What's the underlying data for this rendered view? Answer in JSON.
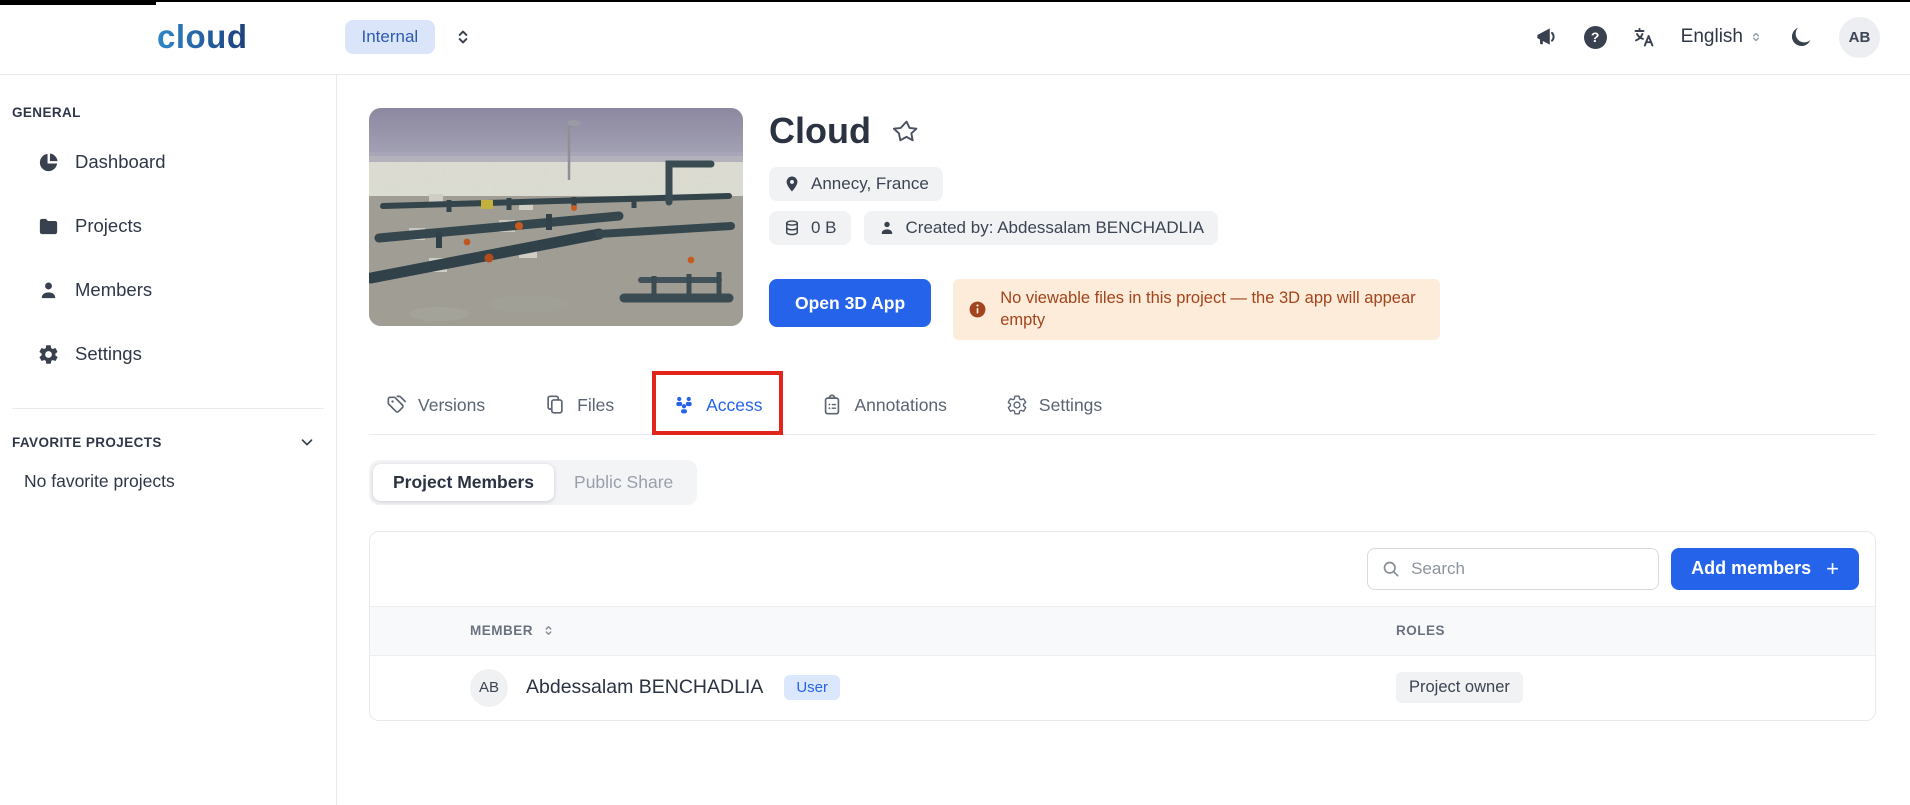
{
  "colors": {
    "accent": "#2563eb",
    "highlight_red": "#e1251b",
    "warning_bg": "#fcecd9",
    "warning_text": "#a2441d",
    "badge_bg": "#f1f2f4",
    "user_badge_bg": "#dbe7fd"
  },
  "header": {
    "logo": "cloud",
    "workspace_badge": "Internal",
    "help_glyph": "?",
    "language": "English",
    "avatar_initials": "AB"
  },
  "sidebar": {
    "general_label": "GENERAL",
    "items": [
      {
        "label": "Dashboard",
        "icon": "pie-chart-icon"
      },
      {
        "label": "Projects",
        "icon": "folder-icon"
      },
      {
        "label": "Members",
        "icon": "person-icon"
      },
      {
        "label": "Settings",
        "icon": "gear-icon"
      }
    ],
    "favorites_label": "FAVORITE PROJECTS",
    "favorites_empty": "No favorite projects"
  },
  "project": {
    "title": "Cloud",
    "location": "Annecy, France",
    "size": "0 B",
    "created_by": "Created by: Abdessalam BENCHADLIA",
    "open_app_button": "Open 3D App",
    "warning": "No viewable files in this project — the 3D app will appear empty"
  },
  "tabs": [
    {
      "label": "Versions",
      "icon": "tag-icon",
      "active": false,
      "highlighted": false
    },
    {
      "label": "Files",
      "icon": "files-icon",
      "active": false,
      "highlighted": false
    },
    {
      "label": "Access",
      "icon": "people-icon",
      "active": true,
      "highlighted": true
    },
    {
      "label": "Annotations",
      "icon": "clipboard-icon",
      "active": false,
      "highlighted": false
    },
    {
      "label": "Settings",
      "icon": "gear-icon",
      "active": false,
      "highlighted": false
    }
  ],
  "subtabs": [
    {
      "label": "Project Members",
      "active": true
    },
    {
      "label": "Public Share",
      "active": false
    }
  ],
  "members_panel": {
    "search_placeholder": "Search",
    "add_members_button": "Add members",
    "plus_glyph": "+",
    "columns": [
      "MEMBER",
      "ROLES"
    ],
    "rows": [
      {
        "initials": "AB",
        "name": "Abdessalam BENCHADLIA",
        "badge": "User",
        "role": "Project owner"
      }
    ]
  }
}
